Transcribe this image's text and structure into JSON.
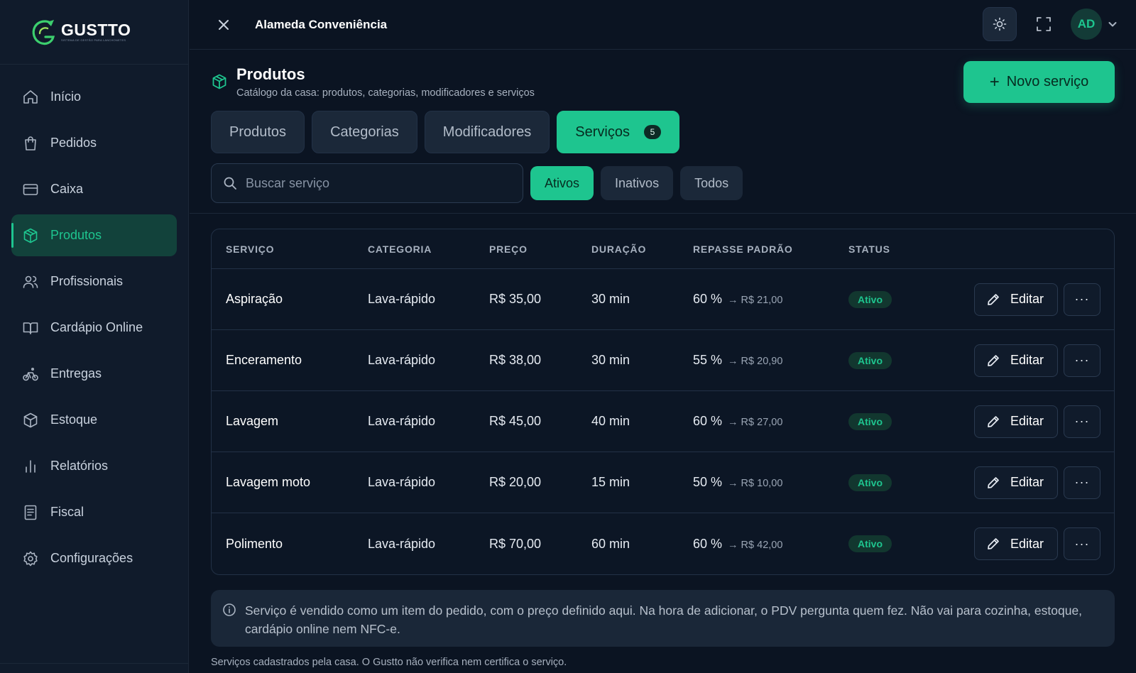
{
  "brand": {
    "name": "GUSTTO",
    "tagline": "SISTEMA DE GESTÃO PARA LANCHONETES",
    "accent": "#1ec58f"
  },
  "sidebar": {
    "items": [
      {
        "label": "Início",
        "icon": "home-icon"
      },
      {
        "label": "Pedidos",
        "icon": "shopping-bag-icon"
      },
      {
        "label": "Caixa",
        "icon": "credit-card-icon"
      },
      {
        "label": "Produtos",
        "icon": "package-icon",
        "active": true
      },
      {
        "label": "Profissionais",
        "icon": "users-icon"
      },
      {
        "label": "Cardápio Online",
        "icon": "book-open-icon"
      },
      {
        "label": "Entregas",
        "icon": "bike-icon"
      },
      {
        "label": "Estoque",
        "icon": "box-icon"
      },
      {
        "label": "Relatórios",
        "icon": "bar-chart-icon"
      },
      {
        "label": "Fiscal",
        "icon": "receipt-icon"
      },
      {
        "label": "Configurações",
        "icon": "gear-icon"
      }
    ]
  },
  "header": {
    "store_name": "Alameda Conveniência",
    "avatar_initials": "AD"
  },
  "page": {
    "title": "Produtos",
    "subtitle": "Catálogo da casa: produtos, categorias, modificadores e serviços",
    "new_button": "Novo serviço"
  },
  "tabs": [
    {
      "label": "Produtos"
    },
    {
      "label": "Categorias"
    },
    {
      "label": "Modificadores"
    },
    {
      "label": "Serviços",
      "count": "5",
      "active": true
    }
  ],
  "search": {
    "placeholder": "Buscar serviço",
    "value": ""
  },
  "filters": [
    {
      "label": "Ativos",
      "active": true
    },
    {
      "label": "Inativos"
    },
    {
      "label": "Todos"
    }
  ],
  "table": {
    "headers": [
      "SERVIÇO",
      "CATEGORIA",
      "PREÇO",
      "DURAÇÃO",
      "REPASSE PADRÃO",
      "STATUS"
    ],
    "edit_label": "Editar",
    "more_label": "···",
    "rows": [
      {
        "name": "Aspiração",
        "category": "Lava-rápido",
        "price": "R$ 35,00",
        "duration": "30 min",
        "pct": "60 %",
        "payout": "→ R$ 21,00",
        "status": "Ativo"
      },
      {
        "name": "Enceramento",
        "category": "Lava-rápido",
        "price": "R$ 38,00",
        "duration": "30 min",
        "pct": "55 %",
        "payout": "→ R$ 20,90",
        "status": "Ativo"
      },
      {
        "name": "Lavagem",
        "category": "Lava-rápido",
        "price": "R$ 45,00",
        "duration": "40 min",
        "pct": "60 %",
        "payout": "→ R$ 27,00",
        "status": "Ativo"
      },
      {
        "name": "Lavagem moto",
        "category": "Lava-rápido",
        "price": "R$ 20,00",
        "duration": "15 min",
        "pct": "50 %",
        "payout": "→ R$ 10,00",
        "status": "Ativo"
      },
      {
        "name": "Polimento",
        "category": "Lava-rápido",
        "price": "R$ 70,00",
        "duration": "60 min",
        "pct": "60 %",
        "payout": "→ R$ 42,00",
        "status": "Ativo"
      }
    ]
  },
  "info": {
    "text": "Serviço é vendido como um item do pedido, com o preço definido aqui. Na hora de adicionar, o PDV pergunta quem fez. Não vai para cozinha, estoque, cardápio online nem NFC-e."
  },
  "footnote": "Serviços cadastrados pela casa. O Gustto não verifica nem certifica o serviço."
}
